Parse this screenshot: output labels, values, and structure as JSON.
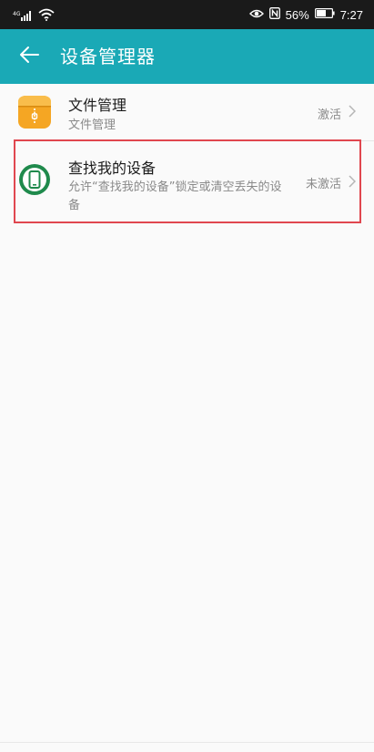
{
  "status_bar": {
    "network": "4G",
    "battery": "56%",
    "time": "7:27"
  },
  "app_bar": {
    "title": "设备管理器",
    "back_icon": "arrow-left-icon"
  },
  "device_admins": [
    {
      "title": "文件管理",
      "subtitle": "文件管理",
      "status": "激活",
      "icon": "file-manager-app-icon"
    },
    {
      "title": "查找我的设备",
      "subtitle": "允许“查找我的设备”锁定或清空丢失的设备",
      "status": "未激活",
      "icon": "find-my-device-app-icon"
    }
  ],
  "colors": {
    "app_bar": "#1aa9b6",
    "highlight": "#e0474f",
    "file_icon": "#f5a623",
    "find_icon": "#1f8a4c"
  }
}
